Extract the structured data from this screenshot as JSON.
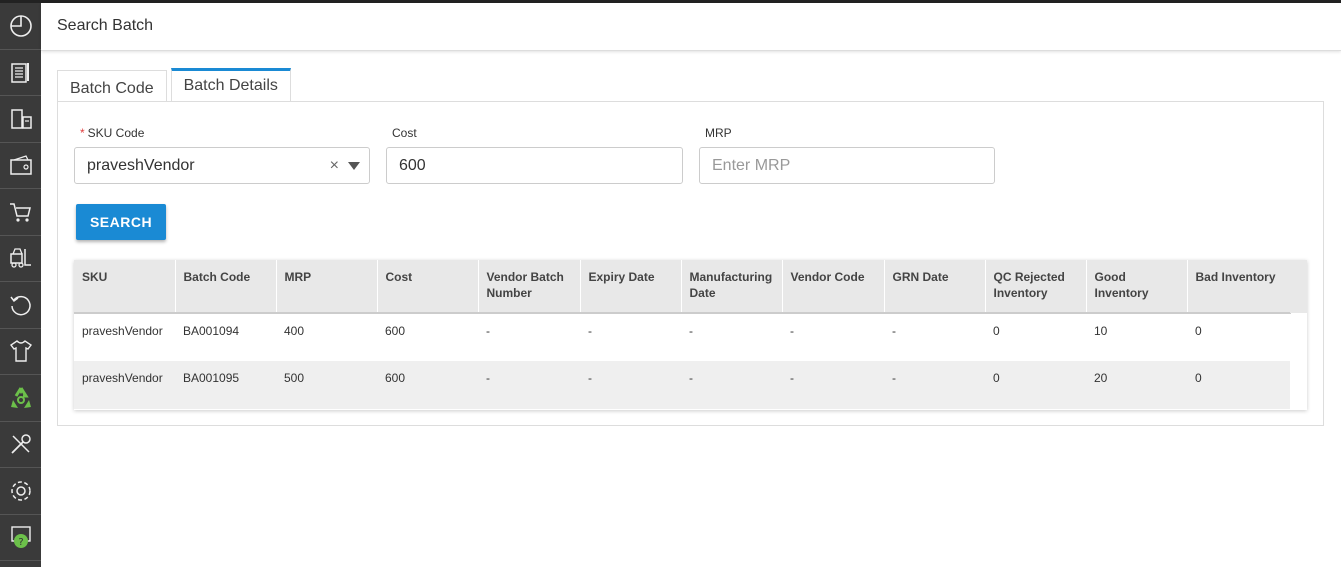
{
  "header": {
    "title": "Search Batch"
  },
  "sidebar": {
    "items": [
      {
        "icon": "dashboard-icon"
      },
      {
        "icon": "documents-icon"
      },
      {
        "icon": "inventory-icon"
      },
      {
        "icon": "wallet-icon"
      },
      {
        "icon": "cart-icon"
      },
      {
        "icon": "forklift-icon"
      },
      {
        "icon": "returns-icon"
      },
      {
        "icon": "apparel-icon"
      },
      {
        "icon": "recycle-icon"
      },
      {
        "icon": "tools-icon"
      },
      {
        "icon": "settings-icon"
      },
      {
        "icon": "help-icon"
      }
    ]
  },
  "tabs": [
    {
      "label": "Batch Code",
      "active": false
    },
    {
      "label": "Batch Details",
      "active": true
    }
  ],
  "form": {
    "sku": {
      "label": "SKU Code",
      "value": "praveshVendor",
      "required_mark": "*"
    },
    "cost": {
      "label": "Cost",
      "value": "600"
    },
    "mrp": {
      "label": "MRP",
      "placeholder": "Enter MRP"
    },
    "clear_glyph": "×",
    "search_label": "SEARCH"
  },
  "table": {
    "columns": [
      "SKU",
      "Batch Code",
      "MRP",
      "Cost",
      "Vendor Batch Number",
      "Expiry Date",
      "Manufacturing Date",
      "Vendor Code",
      "GRN Date",
      "QC Rejected Inventory",
      "Good Inventory",
      "Bad Inventory"
    ],
    "rows": [
      [
        "praveshVendor",
        "BA001094",
        "400",
        "600",
        "-",
        "-",
        "-",
        "-",
        "-",
        "0",
        "10",
        "0"
      ],
      [
        "praveshVendor",
        "BA001095",
        "500",
        "600",
        "-",
        "-",
        "-",
        "-",
        "-",
        "0",
        "20",
        "0"
      ]
    ]
  },
  "colors": {
    "accent": "#1a8ad4",
    "sidebar": "#3a3a3a",
    "recycle": "#6cc04a"
  }
}
